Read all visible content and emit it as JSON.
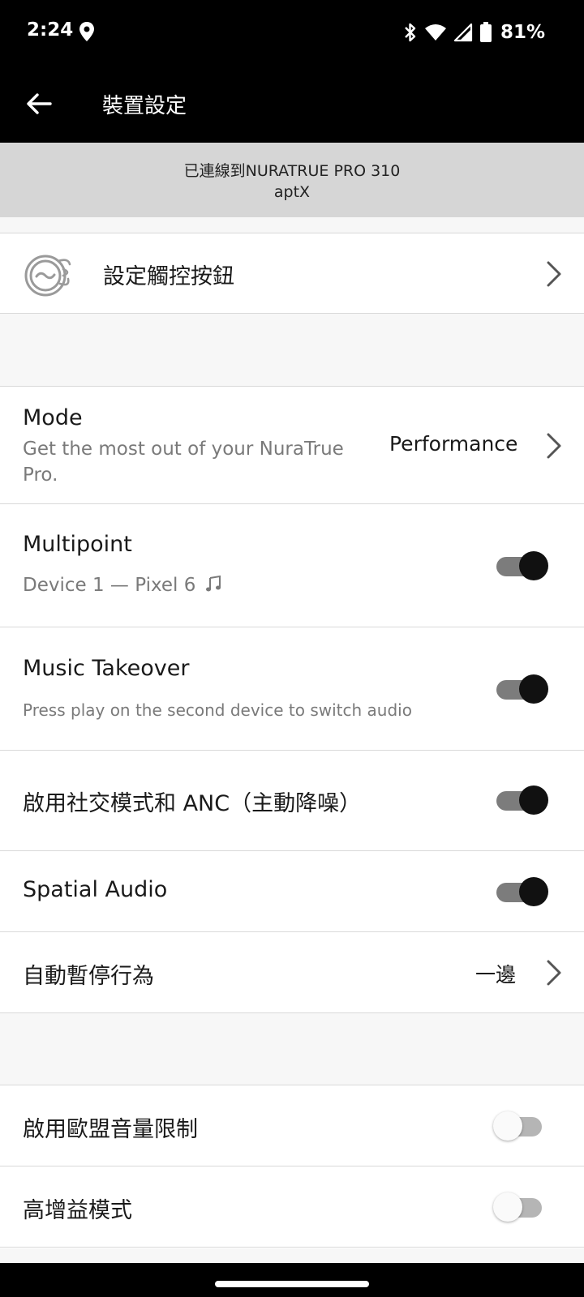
{
  "status_bar": {
    "time": "2:24",
    "battery_percent": "81%",
    "icons": [
      "location-icon",
      "bluetooth-icon",
      "wifi-icon",
      "signal-icon",
      "battery-icon"
    ]
  },
  "app_bar": {
    "title": "裝置設定",
    "back_icon": "arrow-left-icon"
  },
  "connection": {
    "line1": "已連線到NURATRUE PRO 310",
    "line2": "aptX"
  },
  "touch_buttons": {
    "label": "設定觸控按鈕",
    "icon": "earbud-icon"
  },
  "mode": {
    "title": "Mode",
    "subtitle": "Get the most out of your NuraTrue Pro.",
    "value": "Performance"
  },
  "multipoint": {
    "title": "Multipoint",
    "subtitle": "Device 1 — Pixel 6",
    "subtitle_icon": "music-note-icon",
    "enabled": true
  },
  "music_takeover": {
    "title": "Music Takeover",
    "subtitle": "Press play on the second device to switch audio",
    "enabled": true
  },
  "social_anc": {
    "title": "啟用社交模式和 ANC（主動降噪）",
    "enabled": true
  },
  "spatial_audio": {
    "title": "Spatial Audio",
    "enabled": true
  },
  "auto_pause": {
    "title": "自動暫停行為",
    "value": "一邊"
  },
  "eu_volume_limit": {
    "title": "啟用歐盟音量限制",
    "enabled": false
  },
  "high_gain": {
    "title": "高增益模式",
    "enabled": false
  },
  "colors": {
    "bar_background": "#000000",
    "banner_background": "#d6d6d6",
    "page_background": "#f7f7f7",
    "toggle_on_knob": "#111111",
    "toggle_on_track": "#7c7c7c"
  }
}
